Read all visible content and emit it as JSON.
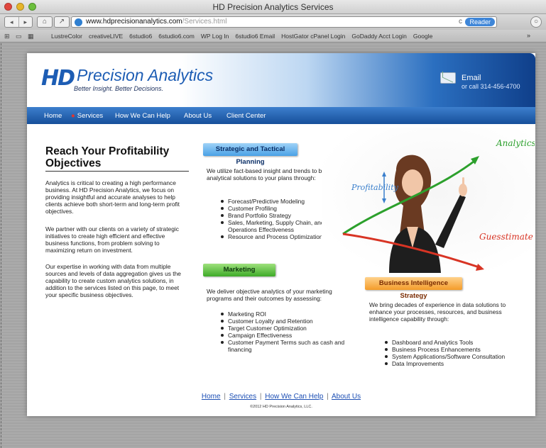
{
  "window": {
    "title": "HD Precision Analytics Services"
  },
  "toolbar": {
    "back_glyph": "◂",
    "forward_glyph": "▸",
    "url_host": "www.hdprecisionanalytics.com",
    "url_path": "/Services.html",
    "reader_label": "Reader",
    "reload_glyph": "c"
  },
  "bookmarks": {
    "items": [
      "LustreColor",
      "creativeLIVE",
      "6studio6",
      "6studio6.com",
      "WP Log In",
      "6studio6 Email",
      "HostGator cPanel Login",
      "GoDaddy Acct Login",
      "Google"
    ],
    "more": "»"
  },
  "header": {
    "logo_mark": "HD",
    "logo_name": "Precision Analytics",
    "tagline": "Better Insight. Better Decisions.",
    "email_label": "Email",
    "phone": "or call 314-456-4700"
  },
  "nav": {
    "home": "Home",
    "services": "Services",
    "how_we_can_help": "How We Can Help",
    "about_us": "About Us",
    "client_center": "Client Center"
  },
  "intro": {
    "heading": "Reach Your Profitability Objectives",
    "p1": "Analytics is critical to creating a high performance business. At HD Precision Analytics, we focus on providing insightful and accurate analyses to help clients achieve both short-term and long-term profit objectives.",
    "p2": "We partner with our clients on a variety of strategic initiatives to create high efficient and effective business functions, from problem solving to maximizing return on investment.",
    "p3": "Our expertise in working with data from multiple sources and levels of data aggregation gives us the capability to create custom analytics solutions, in addition to the services listed on this page, to meet your specific business objectives."
  },
  "strategic": {
    "title": "Strategic and Tactical Planning",
    "text": "We utilize fact-based insight and trends to bring analytical solutions to your plans through:",
    "items": [
      "Forecast/Predictive Modeling",
      "Customer Profiling",
      "Brand Portfolio Strategy",
      "Sales, Marketing, Supply Chain, and Operations Effectiveness",
      "Resource and Process Optimization"
    ]
  },
  "marketing": {
    "title": "Marketing",
    "text": "We deliver objective analytics of your marketing programs and their outcomes by assessing:",
    "items": [
      "Marketing ROI",
      "Customer Loyalty and Retention",
      "Target Customer Optimization",
      "Campaign Effectiveness",
      "Customer Payment Terms such as cash and financing"
    ]
  },
  "bi": {
    "title": "Business Intelligence Strategy",
    "text": "We bring decades of experience in data solutions to enhance your processes, resources, and business intelligence capability through:",
    "items": [
      "Dashboard and Analytics Tools",
      "Business Process Enhancements",
      "System Applications/Software Consultation",
      "Data Improvements"
    ]
  },
  "hero": {
    "analytics": "Analytics",
    "profitability": "Profitability",
    "guesstimate": "Guesstimate"
  },
  "footer": {
    "home": "Home",
    "services": "Services",
    "help": "How We Can Help",
    "about": "About Us",
    "separator": "|",
    "copyright": "©2012 HD Precision Analytics, LLC."
  },
  "colors": {
    "brand_blue": "#1d5db4",
    "nav_blue": "#164f9a",
    "strategic_pill": "#4aa1e6",
    "marketing_pill": "#3eaa28",
    "bi_pill": "#f49c2a"
  }
}
